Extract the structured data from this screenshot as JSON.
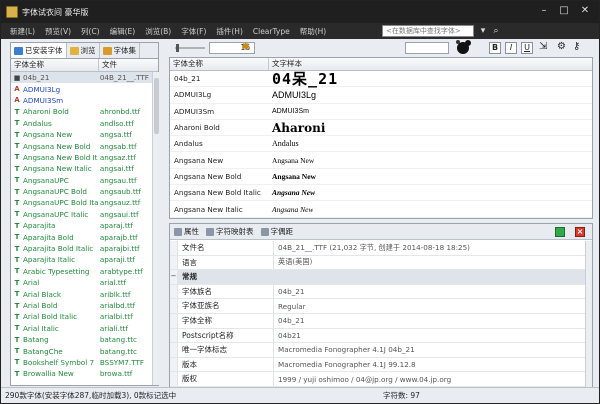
{
  "app": {
    "title": "字体试衣间 豪华版"
  },
  "menu": [
    "新建(L)",
    "预览(V)",
    "列(C)",
    "编辑(E)",
    "浏览(B)",
    "字体(F)",
    "插件(H)",
    "ClearType",
    "帮助(H)"
  ],
  "search": {
    "placeholder": "<在数据库中查找字体>"
  },
  "left_tabs": [
    "已安装字体",
    "浏览",
    "字体集"
  ],
  "left_columns": {
    "name": "字体全称",
    "file": "文件"
  },
  "fonts": [
    {
      "name": "04b_21",
      "file": "04B_21__.TTF",
      "color": "sel",
      "icon": "■"
    },
    {
      "name": "ADMUI3Lg",
      "file": "",
      "color": "blue",
      "icon": "A"
    },
    {
      "name": "ADMUI3Sm",
      "file": "",
      "color": "blue",
      "icon": "A"
    },
    {
      "name": "Aharoni Bold",
      "file": "ahronbd.ttf",
      "color": "green",
      "icon": "T"
    },
    {
      "name": "Andalus",
      "file": "andlso.ttf",
      "color": "green",
      "icon": "T"
    },
    {
      "name": "Angsana New",
      "file": "angsa.ttf",
      "color": "green",
      "icon": "T"
    },
    {
      "name": "Angsana New Bold",
      "file": "angsab.ttf",
      "color": "green",
      "icon": "T"
    },
    {
      "name": "Angsana New Bold It...",
      "file": "angsaz.ttf",
      "color": "green",
      "icon": "T"
    },
    {
      "name": "Angsana New Italic",
      "file": "angsai.ttf",
      "color": "green",
      "icon": "T"
    },
    {
      "name": "AngsanaUPC",
      "file": "angsau.ttf",
      "color": "green",
      "icon": "T"
    },
    {
      "name": "AngsanaUPC Bold",
      "file": "angsaub.ttf",
      "color": "green",
      "icon": "T"
    },
    {
      "name": "AngsanaUPC Bold Ita...",
      "file": "angsauz.ttf",
      "color": "green",
      "icon": "T"
    },
    {
      "name": "AngsanaUPC Italic",
      "file": "angsaui.ttf",
      "color": "green",
      "icon": "T"
    },
    {
      "name": "Aparajita",
      "file": "aparaj.ttf",
      "color": "green",
      "icon": "T"
    },
    {
      "name": "Aparajita Bold",
      "file": "aparajb.ttf",
      "color": "green",
      "icon": "T"
    },
    {
      "name": "Aparajita Bold Italic",
      "file": "aparajbi.ttf",
      "color": "green",
      "icon": "T"
    },
    {
      "name": "Aparajita Italic",
      "file": "aparaji.ttf",
      "color": "green",
      "icon": "T"
    },
    {
      "name": "Arabic Typesetting",
      "file": "arabtype.ttf",
      "color": "green",
      "icon": "T"
    },
    {
      "name": "Arial",
      "file": "arial.ttf",
      "color": "green",
      "icon": "T"
    },
    {
      "name": "Arial Black",
      "file": "ariblk.ttf",
      "color": "green",
      "icon": "T"
    },
    {
      "name": "Arial Bold",
      "file": "arialbd.ttf",
      "color": "green",
      "icon": "T"
    },
    {
      "name": "Arial Bold Italic",
      "file": "arialbi.ttf",
      "color": "green",
      "icon": "T"
    },
    {
      "name": "Arial Italic",
      "file": "ariali.ttf",
      "color": "green",
      "icon": "T"
    },
    {
      "name": "Batang",
      "file": "batang.ttc",
      "color": "green",
      "icon": "T"
    },
    {
      "name": "BatangChe",
      "file": "batang.ttc",
      "color": "green",
      "icon": "T"
    },
    {
      "name": "Bookshelf Symbol 7",
      "file": "BSSYM7.TTF",
      "color": "green",
      "icon": "T"
    },
    {
      "name": "Browallia New",
      "file": "browa.ttf",
      "color": "green",
      "icon": "T"
    }
  ],
  "toolbar": {
    "size": "16"
  },
  "right_columns": {
    "name": "字体全称",
    "sample": "文字样本"
  },
  "samples": [
    {
      "name": "04b_21",
      "sample": "04呆_21"
    },
    {
      "name": "ADMUI3Lg",
      "sample": "ADMUI3Lg"
    },
    {
      "name": "ADMUI3Sm",
      "sample": "ADMUI3Sm"
    },
    {
      "name": "Aharoni Bold",
      "sample": "Aharoni"
    },
    {
      "name": "Andalus",
      "sample": "Andalus"
    },
    {
      "name": "Angsana New",
      "sample": "Angsana New"
    },
    {
      "name": "Angsana New Bold",
      "sample": "Angsana New"
    },
    {
      "name": "Angsana New Bold Italic",
      "sample": "Angsana New"
    },
    {
      "name": "Angsana New Italic",
      "sample": "Angsana New"
    },
    {
      "name": "AngsanaUPC",
      "sample": "AngsanaUPC"
    }
  ],
  "prop_tabs": [
    "属性",
    "字符映射表",
    "字偶距"
  ],
  "properties": [
    {
      "key": "文件名",
      "value": "04B_21__.TTF (21,032 字节, 创建于 2014-08-18 18:25)",
      "type": "row"
    },
    {
      "key": "语言",
      "value": "英语(美国)",
      "type": "row"
    },
    {
      "key": "常规",
      "value": "",
      "type": "cat"
    },
    {
      "key": "字体族名",
      "value": "04b_21",
      "type": "row"
    },
    {
      "key": "字体亚族名",
      "value": "Regular",
      "type": "row"
    },
    {
      "key": "字体全称",
      "value": "04b_21",
      "type": "row"
    },
    {
      "key": "Postscript名称",
      "value": "04b21",
      "type": "row"
    },
    {
      "key": "唯一字体标志",
      "value": "Macromedia Fonographer 4.1J 04b_21",
      "type": "row"
    },
    {
      "key": "版本",
      "value": "Macromedia Fonographer 4.1J 99.12.8",
      "type": "row"
    },
    {
      "key": "版权",
      "value": "1999 / yuji oshimoo / 04@jp.org / www.04.jp.org",
      "type": "row"
    }
  ],
  "status": {
    "left": "290款字体(安装字体287,临时加载3), 0款标记选中",
    "right": "字符数: 97"
  }
}
